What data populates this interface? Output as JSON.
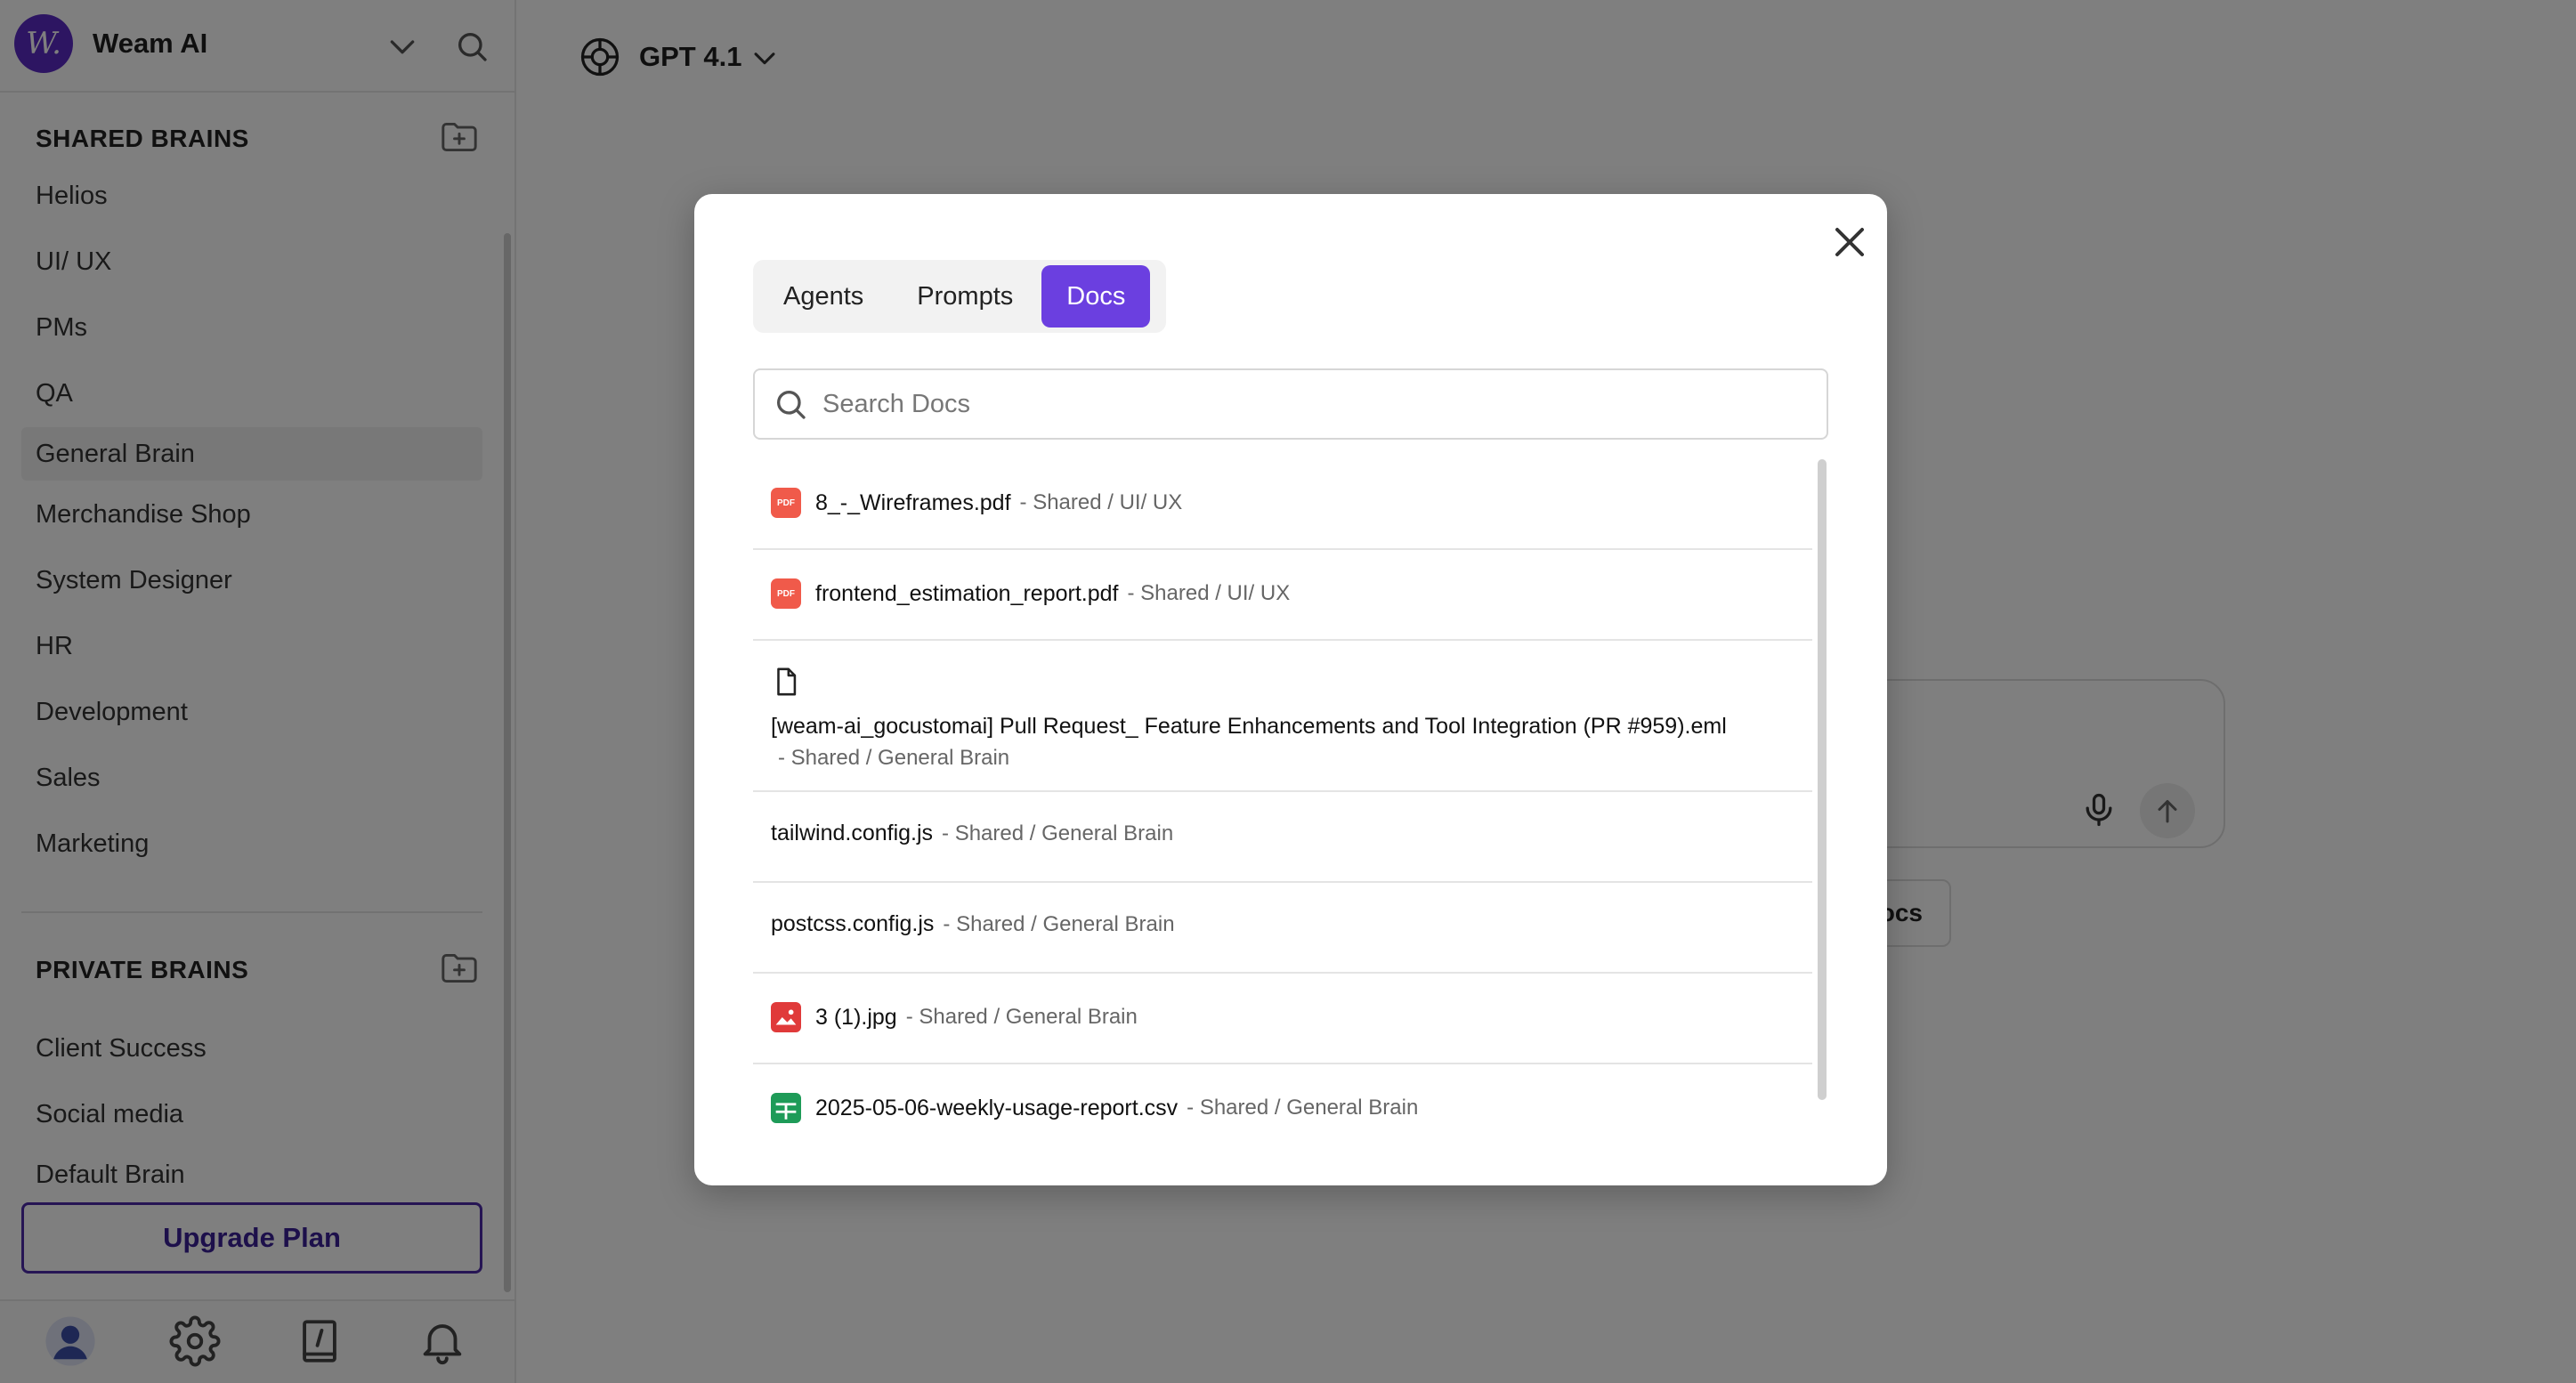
{
  "sidebar": {
    "brand": "Weam AI",
    "shared_title": "SHARED BRAINS",
    "shared_items": [
      "Helios",
      "UI/ UX",
      "PMs",
      "QA",
      "General Brain",
      "Merchandise Shop",
      "System Designer",
      "HR",
      "Development",
      "Sales",
      "Marketing"
    ],
    "private_title": "PRIVATE BRAINS",
    "private_items": [
      "Client Success",
      "Social media",
      "Default Brain"
    ],
    "upgrade_label": "Upgrade Plan"
  },
  "main": {
    "model_name": "GPT 4.1",
    "chip_label": "Docs"
  },
  "modal": {
    "tabs": [
      "Agents",
      "Prompts",
      "Docs"
    ],
    "active_tab": "Docs",
    "search_placeholder": "Search Docs",
    "docs": [
      {
        "name": "8_-_Wireframes.pdf",
        "path": "- Shared / UI/ UX",
        "icon": "pdf-icon"
      },
      {
        "name": "frontend_estimation_report.pdf",
        "path": "- Shared / UI/ UX",
        "icon": "pdf-icon"
      },
      {
        "name": "[weam-ai_gocustomai] Pull Request_ Feature Enhancements and Tool Integration (PR #959).eml",
        "path": "- Shared / General Brain",
        "icon": "file-icon"
      },
      {
        "name": "tailwind.config.js",
        "path": "- Shared / General Brain",
        "icon": "none"
      },
      {
        "name": "postcss.config.js",
        "path": "- Shared / General Brain",
        "icon": "none"
      },
      {
        "name": "3 (1).jpg",
        "path": "- Shared / General Brain",
        "icon": "image-icon"
      },
      {
        "name": "2025-05-06-weekly-usage-report.csv",
        "path": "- Shared / General Brain",
        "icon": "sheet-icon"
      }
    ]
  },
  "colors": {
    "accent": "#6b3fe0",
    "brand": "#5b2bc4",
    "pdf": "#f05a4a",
    "csv": "#1e9b58"
  }
}
